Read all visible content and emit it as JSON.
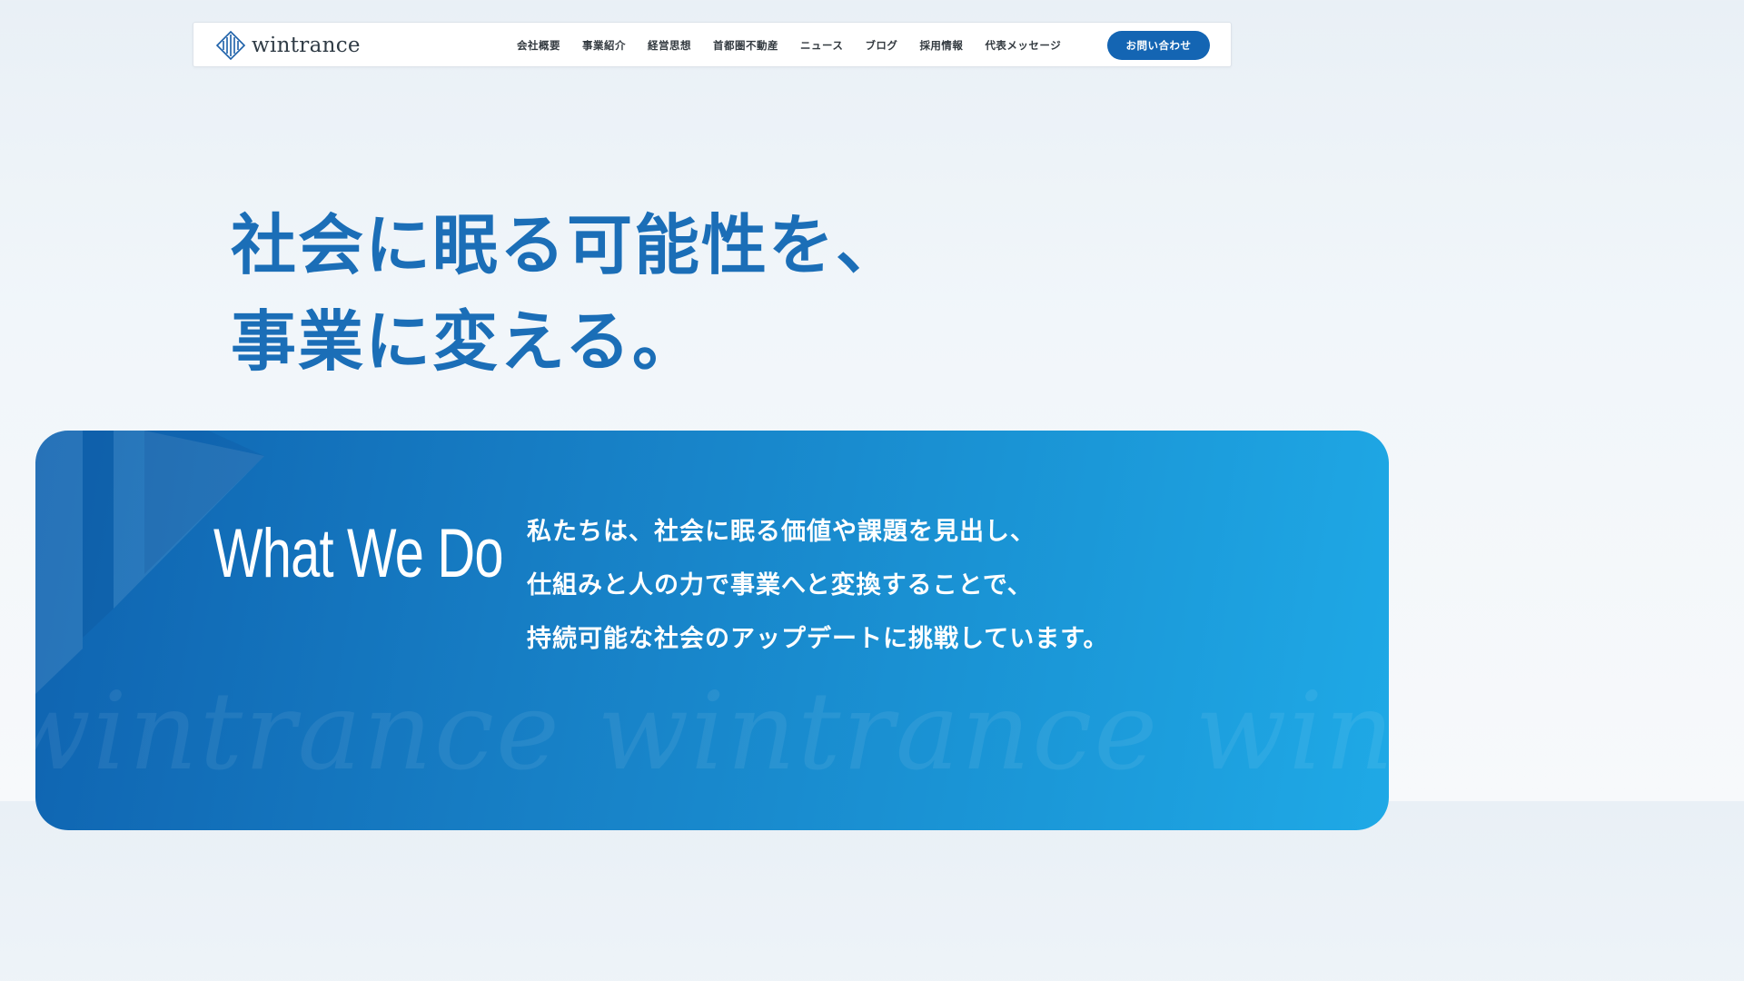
{
  "brand": {
    "name": "wintrance",
    "logo_icon": "wintrance-diamond-logo",
    "accent_color": "#1465b3"
  },
  "nav": {
    "items": [
      {
        "label": "会社概要"
      },
      {
        "label": "事業紹介"
      },
      {
        "label": "経営思想"
      },
      {
        "label": "首都圏不動産"
      },
      {
        "label": "ニュース"
      },
      {
        "label": "ブログ"
      },
      {
        "label": "採用情報"
      },
      {
        "label": "代表メッセージ"
      }
    ],
    "contact_label": "お問い合わせ"
  },
  "hero": {
    "line1": "社会に眠る可能性を、",
    "line2": "事業に変える。",
    "color": "#1b6eb7"
  },
  "what_we_do": {
    "title": "What We Do",
    "lines": [
      "私たちは、社会に眠る価値や課題を見出し、",
      "仕組みと人の力で事業へと変換することで、",
      "持続可能な社会のアップデートに挑戦しています。"
    ],
    "watermark": "wintrance wintrance wintrance"
  }
}
